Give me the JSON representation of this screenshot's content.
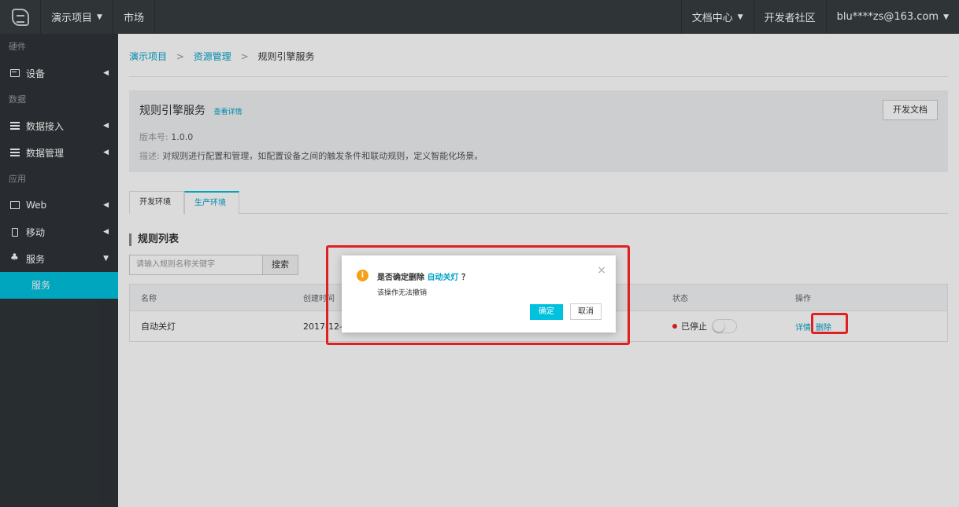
{
  "topbar": {
    "project_menu": "演示项目",
    "market": "市场",
    "docs_center": "文档中心",
    "dev_community": "开发者社区",
    "account": "blu****zs@163.com"
  },
  "sidebar": {
    "groups": [
      {
        "label": "硬件"
      },
      {
        "label": "数据"
      },
      {
        "label": "应用"
      }
    ],
    "items": [
      {
        "label": "设备"
      },
      {
        "label": "数据接入"
      },
      {
        "label": "数据管理"
      },
      {
        "label": "Web"
      },
      {
        "label": "移动"
      },
      {
        "label": "服务"
      }
    ],
    "sub_item": "服务"
  },
  "breadcrumb": {
    "items": [
      "演示项目",
      "资源管理",
      "规则引擎服务"
    ],
    "separator": ">"
  },
  "service": {
    "title": "规则引擎服务",
    "details_link": "查看详情",
    "version_label": "版本号:",
    "version": "1.0.0",
    "desc_label": "描述:",
    "description": "对规则进行配置和管理，如配置设备之间的触发条件和联动规则，定义智能化场景。",
    "doc_button": "开发文档"
  },
  "tabs": [
    {
      "label": "开发环境",
      "active": false
    },
    {
      "label": "生产环境",
      "active": true
    }
  ],
  "rules": {
    "section_title": "规则列表",
    "search_placeholder": "请输入规则名称关键字",
    "search_button": "搜索",
    "columns": [
      "名称",
      "创建时间",
      "状态",
      "操作"
    ],
    "rows": [
      {
        "name": "自动关灯",
        "created": "2017-12-1",
        "status": "已停止",
        "actions": [
          "详情",
          "删除"
        ]
      }
    ]
  },
  "modal": {
    "title_prefix": "是否确定删除",
    "title_target": "自动关灯",
    "title_suffix": "？",
    "message": "该操作无法撤销",
    "ok_label": "确定",
    "cancel_label": "取消",
    "close_icon": "×"
  },
  "colors": {
    "topbar": "#373d41",
    "sidebar": "#2f3438",
    "accent": "#00c1de",
    "link": "#00a2ca",
    "warning": "#f5a015",
    "status_stopped": "#e22222",
    "annotation": "#e02020"
  }
}
